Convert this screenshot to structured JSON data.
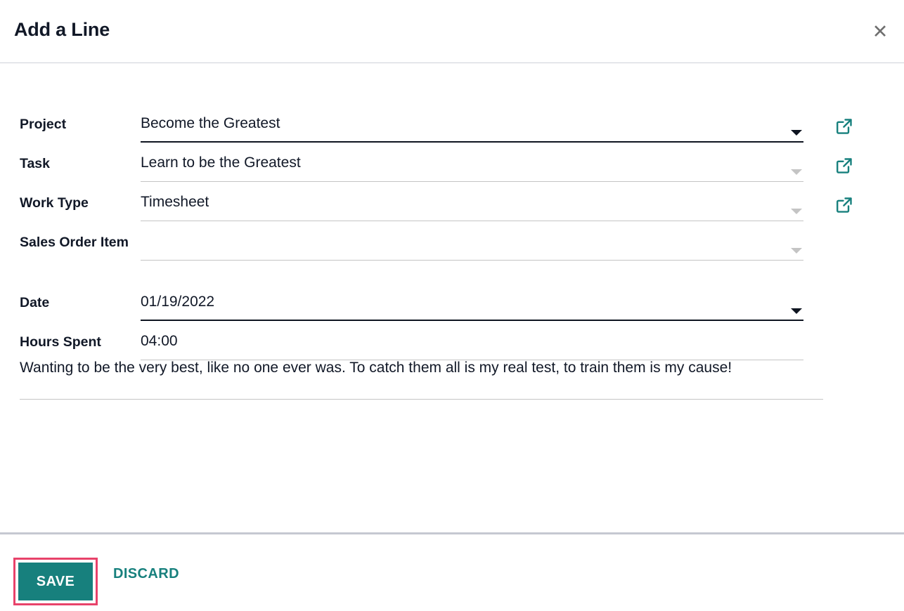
{
  "dialog": {
    "title": "Add a Line",
    "close_icon": "close-icon",
    "close_glyph": "✕"
  },
  "colors": {
    "accent_teal": "#17807d",
    "highlight_pink": "#e8426a",
    "text_dark": "#111827",
    "underline_gray": "#c4c4c4",
    "underline_focused": "#0e1420",
    "divider": "#c5c8d1"
  },
  "form": {
    "fields": [
      {
        "label": "Project",
        "value": "Become the Greatest",
        "has_caret": true,
        "caret_dark": true,
        "focused": true,
        "has_link_icon": true,
        "link_icon": "external-link-icon"
      },
      {
        "label": "Task",
        "value": "Learn to be the Greatest",
        "has_caret": true,
        "caret_dark": false,
        "focused": false,
        "has_link_icon": true,
        "link_icon": "external-link-icon"
      },
      {
        "label": "Work Type",
        "value": "Timesheet",
        "has_caret": true,
        "caret_dark": false,
        "focused": false,
        "has_link_icon": true,
        "link_icon": "external-link-icon"
      },
      {
        "label": "Sales Order Item",
        "value": "",
        "has_caret": true,
        "caret_dark": false,
        "focused": false,
        "has_link_icon": false,
        "link_icon": ""
      },
      {
        "label": "Date",
        "value": "01/19/2022",
        "has_caret": true,
        "caret_dark": true,
        "focused": true,
        "has_link_icon": false,
        "link_icon": ""
      },
      {
        "label": "Hours Spent",
        "value": "04:00",
        "has_caret": false,
        "caret_dark": false,
        "focused": false,
        "has_link_icon": false,
        "link_icon": ""
      }
    ],
    "description": "Wanting to be the very best, like no one ever was. To catch them all is my real test, to train them is my cause!"
  },
  "footer": {
    "save_label": "SAVE",
    "discard_label": "DISCARD"
  }
}
